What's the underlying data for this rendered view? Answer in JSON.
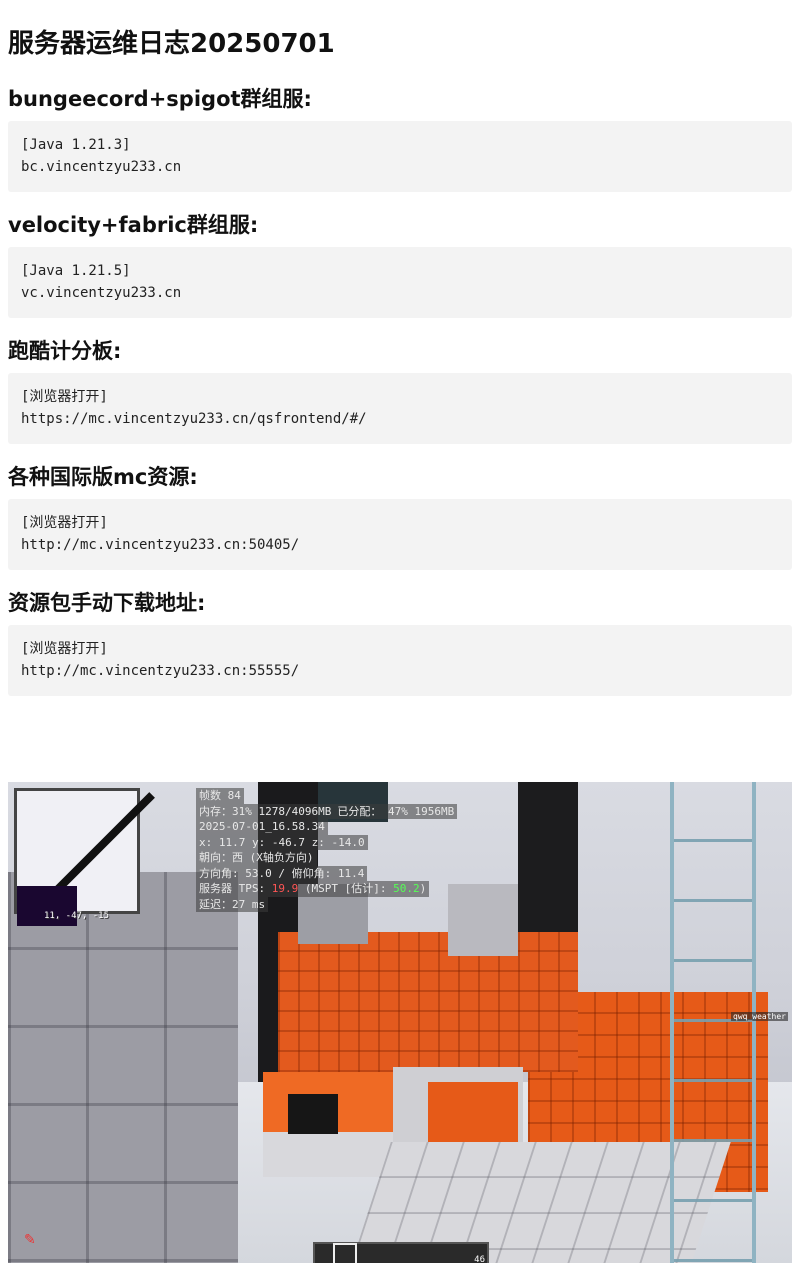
{
  "page": {
    "title": "服务器运维日志20250701"
  },
  "sections": [
    {
      "heading": "bungeecord+spigot群组服:",
      "lines": [
        "[Java 1.21.3]",
        "bc.vincentzyu233.cn"
      ]
    },
    {
      "heading": "velocity+fabric群组服:",
      "lines": [
        "[Java 1.21.5]",
        "vc.vincentzyu233.cn"
      ]
    },
    {
      "heading": "跑酷计分板:",
      "lines": [
        "[浏览器打开]",
        "https://mc.vincentzyu233.cn/qsfrontend/#/"
      ]
    },
    {
      "heading": "各种国际版mc资源:",
      "lines": [
        "[浏览器打开]",
        "http://mc.vincentzyu233.cn:50405/"
      ]
    },
    {
      "heading": "资源包手动下载地址:",
      "lines": [
        "[浏览器打开]",
        "http://mc.vincentzyu233.cn:55555/"
      ]
    }
  ],
  "game": {
    "minimap_coords": "11, -47, -15",
    "debug": {
      "fps": "帧数 84",
      "memory_a": "内存：31% 1278/4096MB",
      "memory_b": "已分配： 47% 1956MB",
      "datetime": "2025-07-01_16.58.34",
      "position": "x: 11.7 y: -46.7 z: -14.0",
      "facing": "朝向：西 (X轴负方向)",
      "angles": "方向角: 53.0 / 俯仰角: 11.4",
      "tps_label": "服务器 TPS:",
      "tps_value": "19.9",
      "mspt_label": "(MSPT [估计]:",
      "mspt_value": "50.2",
      "mspt_close": ")",
      "latency": "延迟：27 ms"
    },
    "weather_tag": "qwq_weather",
    "hotbar_count": "46"
  }
}
